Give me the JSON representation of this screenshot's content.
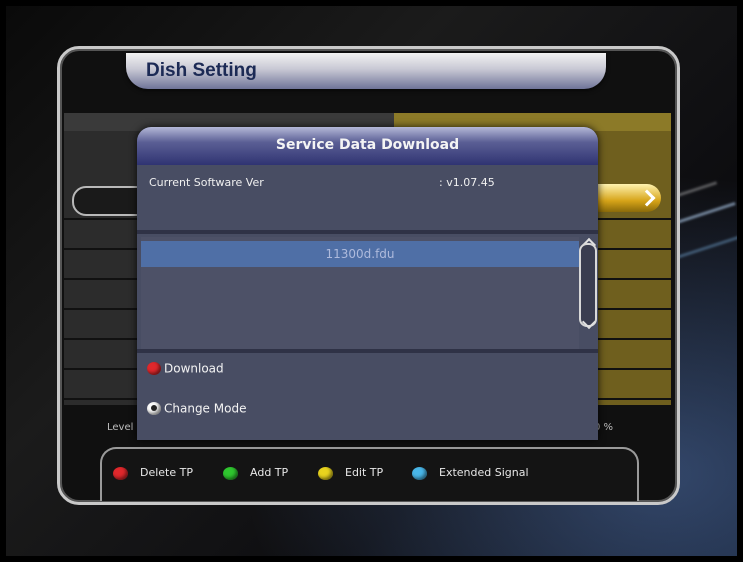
{
  "dish": {
    "title": "Dish Setting",
    "level_label": "Level",
    "percent_label": "0 %"
  },
  "legend": [
    {
      "label": "Delete TP",
      "color": "#e0282c"
    },
    {
      "label": "Add TP",
      "color": "#2fc62f"
    },
    {
      "label": "Edit TP",
      "color": "#e8d31e"
    },
    {
      "label": "Extended Signal",
      "color": "#49b6e8"
    }
  ],
  "dialog": {
    "title": "Service Data Download",
    "software_label": "Current Software Ver",
    "software_value": ": v1.07.45",
    "files": [
      "11300d.fdu"
    ],
    "download_label": "Download",
    "download_color": "#e0282c",
    "change_mode_label": "Change Mode"
  }
}
